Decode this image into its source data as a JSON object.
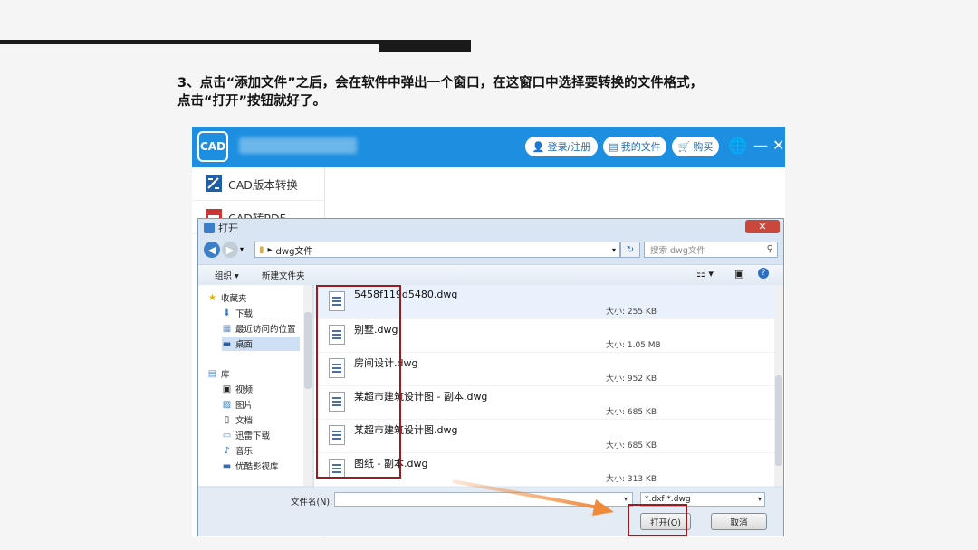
{
  "instruction": {
    "line1": "3、点击“添加文件”之后，会在软件中弹出一个窗口，在这窗口中选择要转换的文件格式，",
    "line2": "点击“打开”按钮就好了。"
  },
  "app": {
    "logo_text": "CAD",
    "header_buttons": {
      "login": "登录/注册",
      "my_files": "我的文件",
      "buy": "购买"
    },
    "window_controls": {
      "minimize": "—",
      "close": "✕"
    },
    "sidebar": [
      {
        "label": "CAD版本转换"
      },
      {
        "label": "CAD转PDF"
      }
    ],
    "colors": {
      "brand": "#1e8fe0",
      "highlight": "#9b1c20",
      "arrow": "#f08a3a"
    }
  },
  "dialog": {
    "title": "打开",
    "close_symbol": "✕",
    "address": "dwg文件",
    "search_placeholder": "搜索 dwg文件",
    "toolbar": {
      "organize": "组织 ▾",
      "new_folder": "新建文件夹"
    },
    "nav": {
      "favorites": "收藏夹",
      "favorites_items": [
        "下载",
        "最近访问的位置",
        "桌面"
      ],
      "library": "库",
      "library_items": [
        "视频",
        "图片",
        "文档",
        "迅雷下载",
        "音乐",
        "优酷影视库"
      ]
    },
    "files": [
      {
        "name": "5458f119d5480.dwg",
        "size": "大小: 255 KB"
      },
      {
        "name": "别墅.dwg",
        "size": "大小: 1.05 MB"
      },
      {
        "name": "房间设计.dwg",
        "size": "大小: 952 KB"
      },
      {
        "name": "某超市建筑设计图 - 副本.dwg",
        "size": "大小: 685 KB"
      },
      {
        "name": "某超市建筑设计图.dwg",
        "size": "大小: 685 KB"
      },
      {
        "name": "图纸 - 副本.dwg",
        "size": "大小: 313 KB"
      }
    ],
    "filename_label": "文件名(N):",
    "filename_value": "",
    "filetype": "*.dxf *.dwg",
    "open_button": "打开(O)",
    "cancel_button": "取消"
  }
}
